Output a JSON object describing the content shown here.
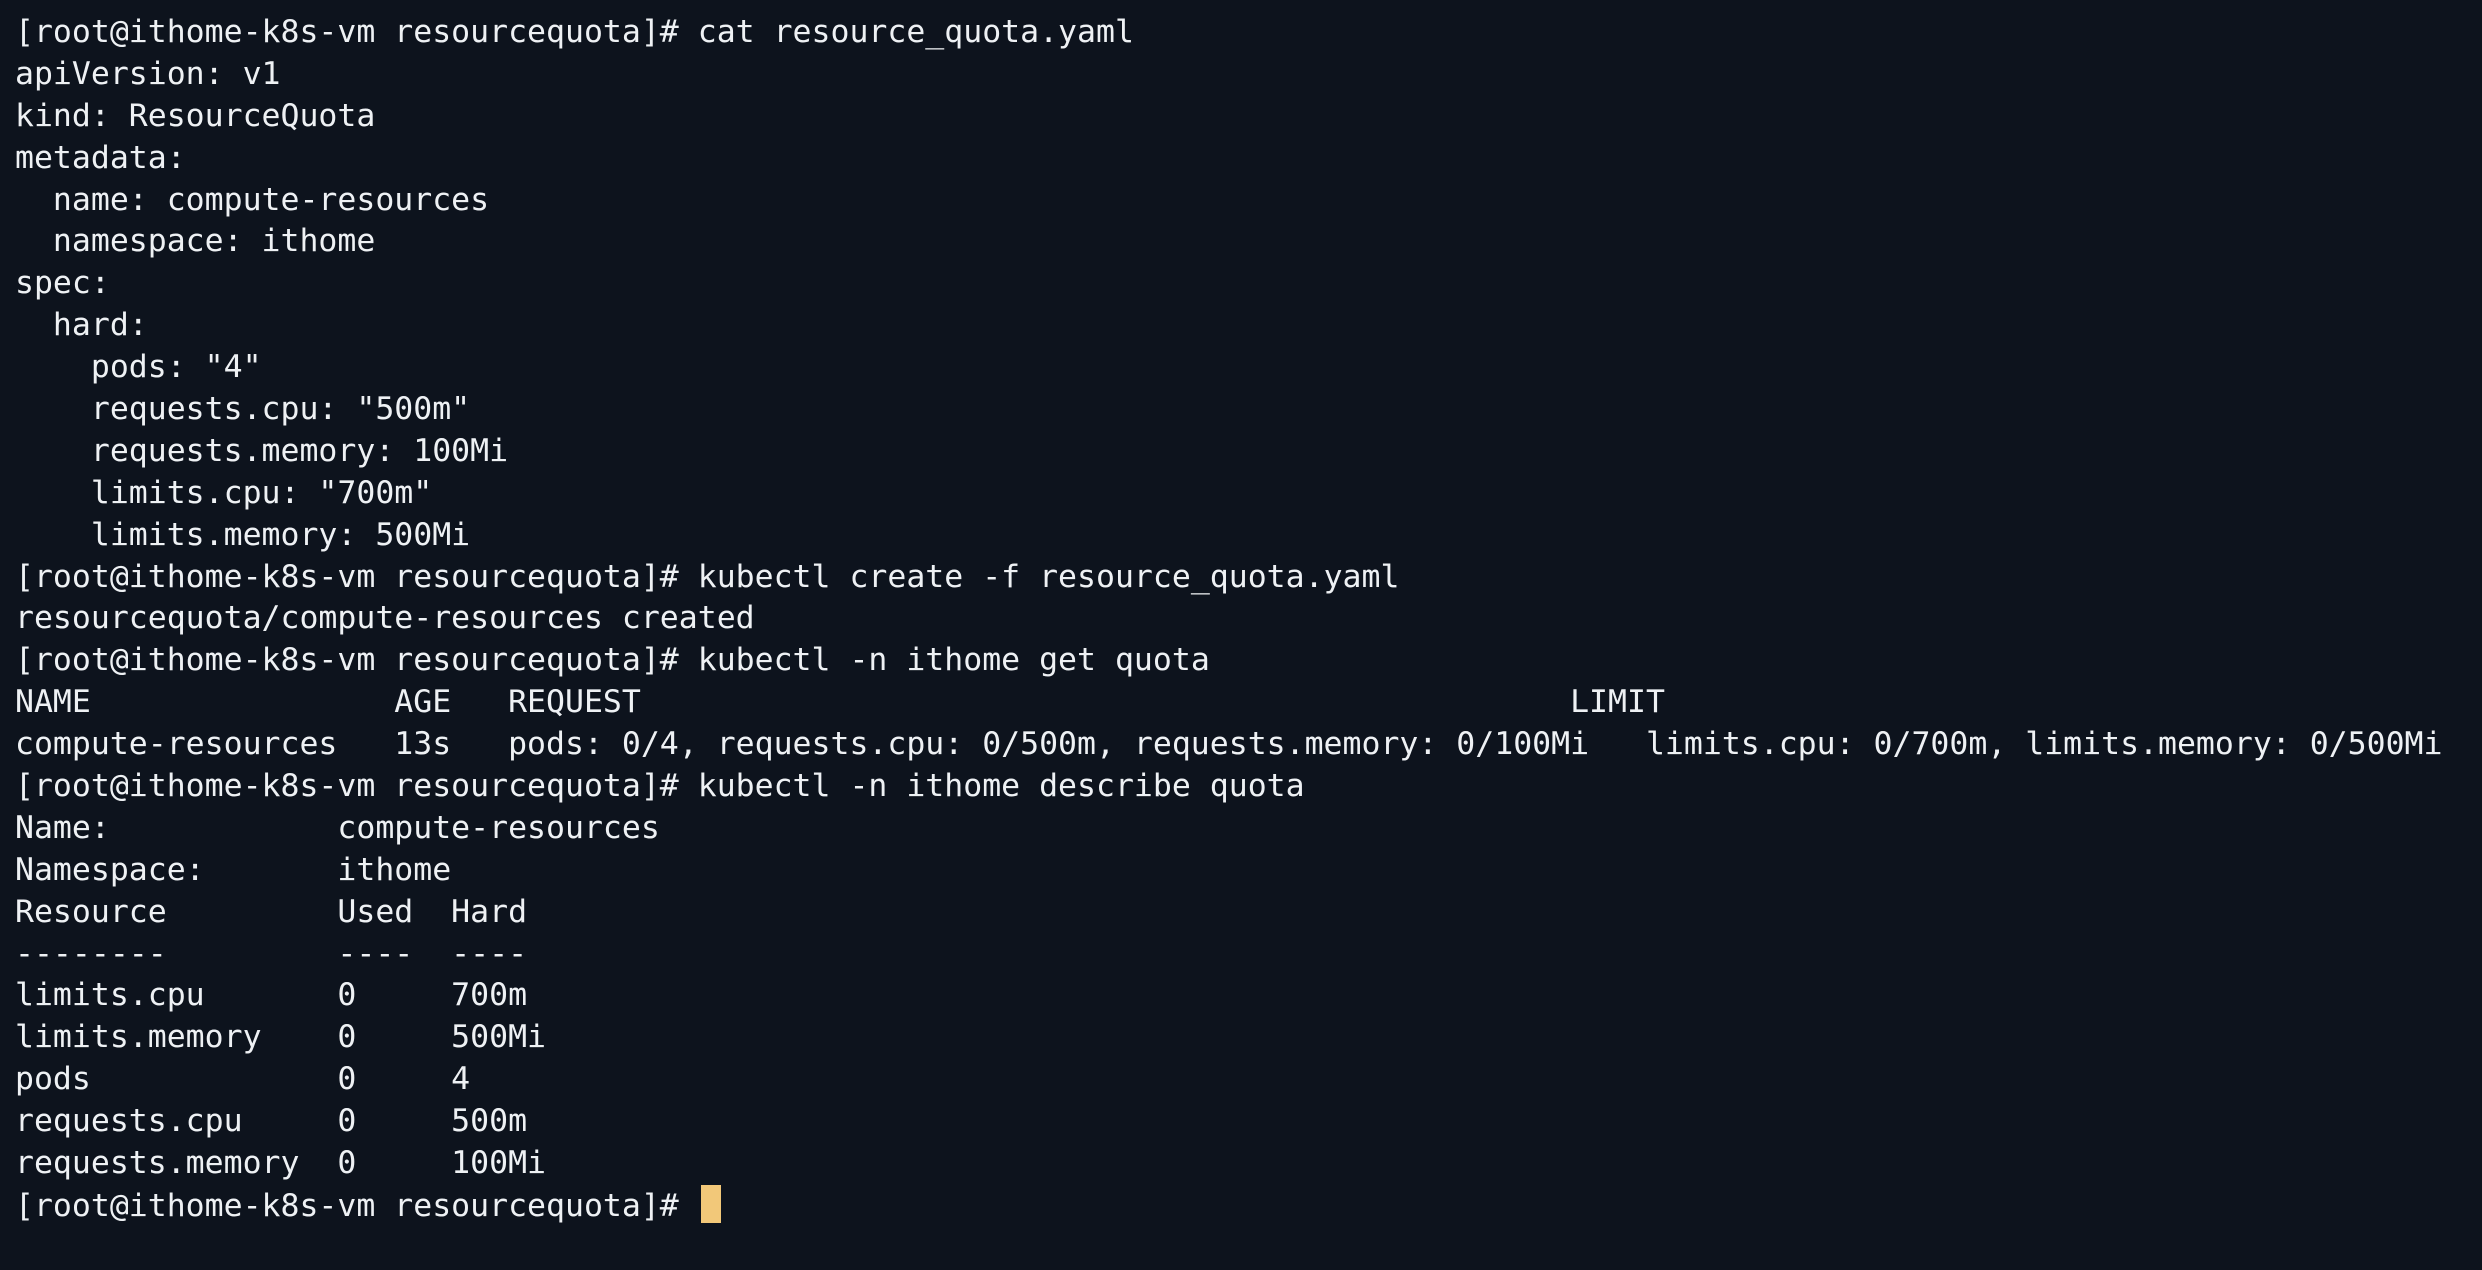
{
  "terminal": {
    "prompt": "[root@ithome-k8s-vm resourcequota]# ",
    "cursor_color": "#f2c879",
    "background_color": "#0d131d",
    "text_color": "#eef1f4",
    "lines": [
      {
        "type": "command",
        "text": "cat resource_quota.yaml"
      },
      {
        "type": "output",
        "text": "apiVersion: v1"
      },
      {
        "type": "output",
        "text": "kind: ResourceQuota"
      },
      {
        "type": "output",
        "text": "metadata:"
      },
      {
        "type": "output",
        "text": "  name: compute-resources"
      },
      {
        "type": "output",
        "text": "  namespace: ithome"
      },
      {
        "type": "output",
        "text": "spec:"
      },
      {
        "type": "output",
        "text": "  hard:"
      },
      {
        "type": "output",
        "text": "    pods: \"4\""
      },
      {
        "type": "output",
        "text": "    requests.cpu: \"500m\""
      },
      {
        "type": "output",
        "text": "    requests.memory: 100Mi"
      },
      {
        "type": "output",
        "text": "    limits.cpu: \"700m\""
      },
      {
        "type": "output",
        "text": "    limits.memory: 500Mi"
      },
      {
        "type": "command",
        "text": "kubectl create -f resource_quota.yaml"
      },
      {
        "type": "output",
        "text": "resourcequota/compute-resources created"
      },
      {
        "type": "command",
        "text": "kubectl -n ithome get quota"
      },
      {
        "type": "output",
        "text": "NAME                AGE   REQUEST                                                 LIMIT"
      },
      {
        "type": "output",
        "text": "compute-resources   13s   pods: 0/4, requests.cpu: 0/500m, requests.memory: 0/100Mi   limits.cpu: 0/700m, limits.memory: 0/500Mi"
      },
      {
        "type": "command",
        "text": "kubectl -n ithome describe quota"
      },
      {
        "type": "output",
        "text": "Name:            compute-resources"
      },
      {
        "type": "output",
        "text": "Namespace:       ithome"
      },
      {
        "type": "output",
        "text": "Resource         Used  Hard"
      },
      {
        "type": "output",
        "text": "--------         ----  ----"
      },
      {
        "type": "output",
        "text": "limits.cpu       0     700m"
      },
      {
        "type": "output",
        "text": "limits.memory    0     500Mi"
      },
      {
        "type": "output",
        "text": "pods             0     4"
      },
      {
        "type": "output",
        "text": "requests.cpu     0     500m"
      },
      {
        "type": "output",
        "text": "requests.memory  0     100Mi"
      },
      {
        "type": "command",
        "text": ""
      }
    ]
  }
}
